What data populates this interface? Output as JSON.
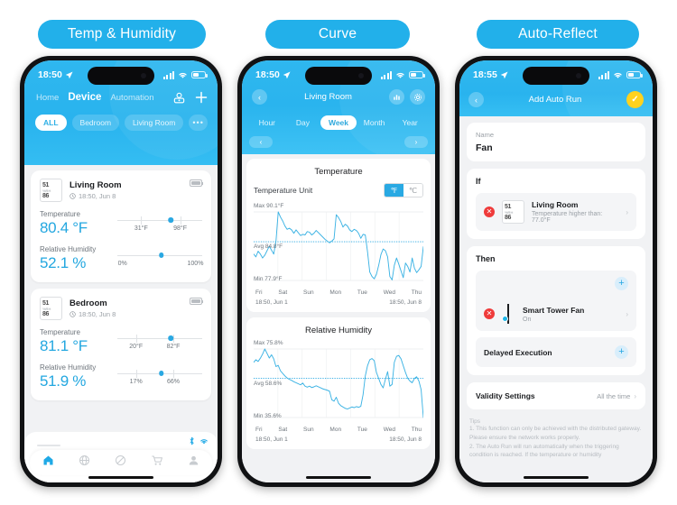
{
  "pills": [
    {
      "label": "Temp & Humidity"
    },
    {
      "label": "Curve"
    },
    {
      "label": "Auto-Reflect"
    }
  ],
  "accent": "#29b3ee",
  "value_color": "#23a7e0",
  "phone1": {
    "status": {
      "time": "18:50",
      "location_icon": "location-arrow-icon"
    },
    "nav": [
      {
        "label": "Home",
        "active": false
      },
      {
        "label": "Device",
        "active": true
      },
      {
        "label": "Automation",
        "active": false
      }
    ],
    "actions": {
      "scene_icon": "scene-icon",
      "add_icon": "plus-icon"
    },
    "chips": [
      {
        "label": "ALL",
        "active": true
      },
      {
        "label": "Bedroom",
        "active": false
      },
      {
        "label": "Living Room",
        "active": false
      },
      {
        "label": "•••",
        "active": false
      }
    ],
    "devices": [
      {
        "name": "Living Room",
        "time": "18:50,  Jun 8",
        "thumb_top": "51",
        "thumb_bottom": "86",
        "temperature": {
          "label": "Temperature",
          "value": "80.4 °F",
          "min_label": "31°F",
          "max_label": "98°F",
          "min_pos": 28,
          "max_pos": 74,
          "dot_pos": 63
        },
        "humidity": {
          "label": "Relative Humidity",
          "value": "52.1 %",
          "min_label": "0%",
          "max_label": "100%",
          "min_pos": 2,
          "max_pos": 98,
          "dot_pos": 52
        }
      },
      {
        "name": "Bedroom",
        "time": "18:50,  Jun 8",
        "thumb_top": "51",
        "thumb_bottom": "86",
        "temperature": {
          "label": "Temperature",
          "value": "81.1 °F",
          "min_label": "20°F",
          "max_label": "82°F",
          "min_pos": 22,
          "max_pos": 66,
          "dot_pos": 63
        },
        "humidity": {
          "label": "Relative Humidity",
          "value": "51.9 %",
          "min_label": "17%",
          "max_label": "66%",
          "min_pos": 22,
          "max_pos": 66,
          "dot_pos": 52
        }
      }
    ],
    "connectivity": [
      "bluetooth-icon",
      "wifi-icon"
    ],
    "tabbar": [
      {
        "name": "home-tab",
        "icon": "home-icon",
        "active": true
      },
      {
        "name": "discover-tab",
        "icon": "globe-icon",
        "active": false
      },
      {
        "name": "scan-tab",
        "icon": "slash-circle-icon",
        "active": false
      },
      {
        "name": "shop-tab",
        "icon": "cart-icon",
        "active": false
      },
      {
        "name": "profile-tab",
        "icon": "person-icon",
        "active": false
      }
    ]
  },
  "phone2": {
    "status": {
      "time": "18:50"
    },
    "title": "Living Room",
    "back_icon": "chevron-left-icon",
    "header_icons": [
      "bar-chart-icon",
      "gear-icon"
    ],
    "segments": [
      {
        "label": "Hour",
        "active": false
      },
      {
        "label": "Day",
        "active": false
      },
      {
        "label": "Week",
        "active": true
      },
      {
        "label": "Month",
        "active": false
      },
      {
        "label": "Year",
        "active": false
      }
    ],
    "pager": {
      "prev": "‹",
      "next": "›"
    },
    "unit_row": {
      "label": "Temperature Unit",
      "options": [
        {
          "label": "℉",
          "selected": true
        },
        {
          "label": "℃",
          "selected": false
        }
      ]
    },
    "range_start": "18:50,  Jun 1",
    "range_end": "18:50,  Jun 8"
  },
  "phone3": {
    "status": {
      "time": "18:55"
    },
    "title": "Add Auto Run",
    "back_icon": "chevron-left-icon",
    "confirm_icon": "check-icon",
    "name_field": {
      "label": "Name",
      "value": "Fan"
    },
    "if_section": {
      "label": "If",
      "item": {
        "name": "Living Room",
        "sub": "Temperature higher than: 77.0°F",
        "thumb_top": "51",
        "thumb_bottom": "86"
      }
    },
    "then_section": {
      "label": "Then",
      "add_icon": "plus-icon",
      "item": {
        "name": "Smart Tower Fan",
        "sub": "On",
        "icon": "tower-fan-icon"
      },
      "delayed": {
        "label": "Delayed Execution",
        "add_icon": "plus-icon"
      }
    },
    "validity": {
      "label": "Validity Settings",
      "value": "All the time",
      "chevron": "chevron-right-icon"
    },
    "tips": {
      "heading": "Tips",
      "lines": [
        "1. This function can only be achieved with the distributed gateway. Please ensure the network works properly.",
        "2. The Auto Run will run automatically when the triggering condition is reached. If the temperature or humidity"
      ]
    }
  },
  "chart_data": [
    {
      "type": "line",
      "title": "Temperature",
      "ylabel": "°F",
      "xlabel": "",
      "max_label": "Max 90.1°F",
      "avg_label": "Avg 84.8°F",
      "min_label": "Min 77.9°F",
      "max": 90.1,
      "avg": 84.8,
      "min": 77.9,
      "ylim": [
        77.9,
        90.1
      ],
      "grid": true,
      "legend": "none",
      "categories": [
        "Fri",
        "Sat",
        "Sun",
        "Mon",
        "Tue",
        "Wed",
        "Thu"
      ],
      "range_start": "18:50,  Jun 1",
      "range_end": "18:50,  Jun 8",
      "values": [
        82.6,
        82.1,
        83.1,
        82.6,
        81.9,
        82.4,
        83.2,
        84.0,
        83.3,
        82.6,
        84.9,
        90.1,
        89.2,
        88.5,
        87.6,
        87.0,
        87.2,
        86.9,
        86.3,
        86.9,
        86.4,
        85.9,
        86.1,
        86.0,
        86.6,
        86.5,
        86.0,
        86.3,
        86.8,
        86.4,
        86.0,
        85.6,
        85.2,
        84.9,
        84.6,
        84.9,
        85.3,
        89.6,
        89.1,
        88.4,
        87.4,
        87.9,
        87.6,
        86.9,
        86.6,
        87.0,
        86.8,
        86.3,
        85.4,
        86.1,
        86.0,
        83.0,
        79.4,
        78.6,
        78.2,
        79.0,
        80.6,
        82.5,
        83.5,
        83.2,
        82.1,
        78.6,
        78.0,
        80.6,
        81.9,
        80.8,
        79.6,
        78.4,
        81.0,
        80.4,
        79.4,
        81.9,
        80.1,
        79.3,
        79.8,
        80.4,
        83.9
      ]
    },
    {
      "type": "line",
      "title": "Relative Humidity",
      "ylabel": "%",
      "xlabel": "",
      "max_label": "Max 75.8%",
      "avg_label": "Avg 58.6%",
      "min_label": "Min 35.6%",
      "max": 75.8,
      "avg": 58.6,
      "min": 35.6,
      "ylim": [
        35.6,
        75.8
      ],
      "grid": true,
      "legend": "none",
      "categories": [
        "Fri",
        "Sat",
        "Sun",
        "Mon",
        "Tue",
        "Wed",
        "Thu"
      ],
      "range_start": "18:50,  Jun 1",
      "range_end": "18:50,  Jun 8",
      "values": [
        68.0,
        69.5,
        68.5,
        70.4,
        72.8,
        75.8,
        73.2,
        70.5,
        72.4,
        70.0,
        65.5,
        66.2,
        63.0,
        61.5,
        60.0,
        58.8,
        58.0,
        57.4,
        56.6,
        56.0,
        55.4,
        54.8,
        55.8,
        54.0,
        53.4,
        54.0,
        53.2,
        53.6,
        54.2,
        53.6,
        53.0,
        52.4,
        52.0,
        51.6,
        51.0,
        46.0,
        45.2,
        47.5,
        44.0,
        42.6,
        41.8,
        41.0,
        40.6,
        41.2,
        41.8,
        41.4,
        42.0,
        41.6,
        42.2,
        49.0,
        60.0,
        66.0,
        69.5,
        70.2,
        69.0,
        62.0,
        58.5,
        55.0,
        53.0,
        58.0,
        62.5,
        54.0,
        55.0,
        68.0,
        71.5,
        72.0,
        70.0,
        66.0,
        62.0,
        58.6,
        57.0,
        56.0,
        58.5,
        59.5,
        57.0,
        52.0,
        35.6
      ]
    }
  ]
}
